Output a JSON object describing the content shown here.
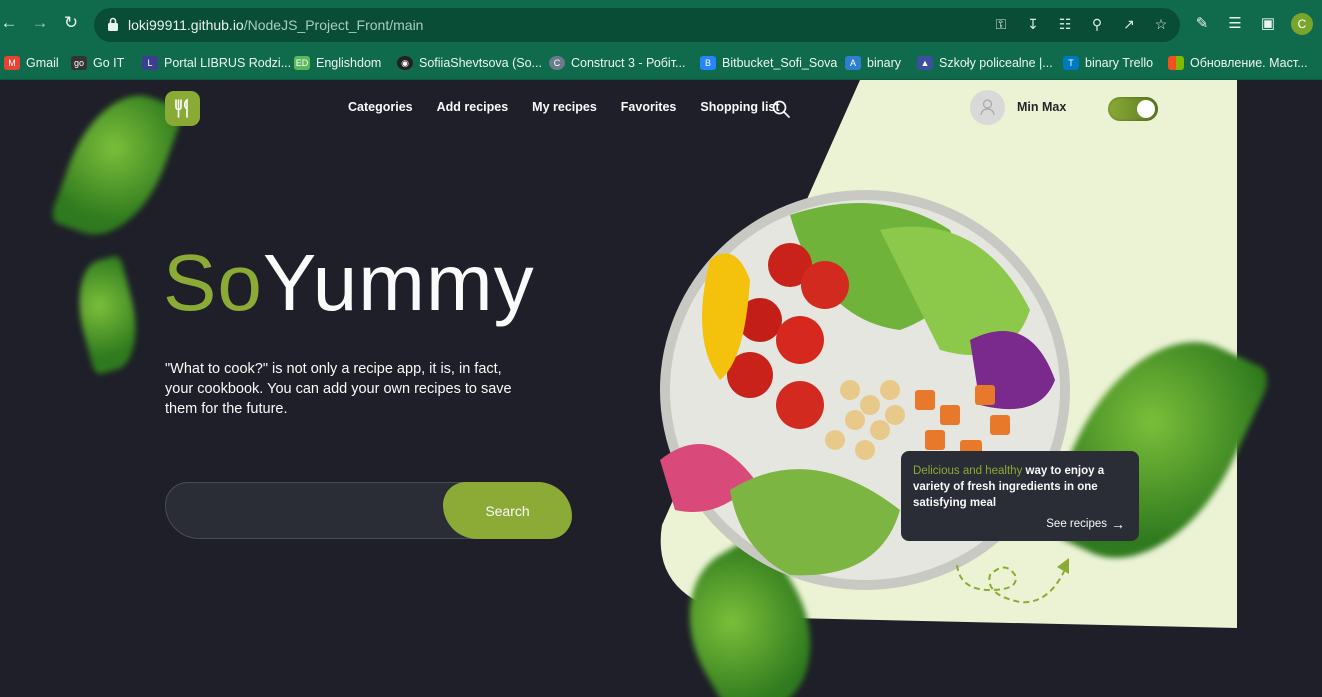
{
  "browser": {
    "url_host": "loki99911.github.io",
    "url_path": "/NodeJS_Project_Front/main",
    "profile_initial": "C",
    "bookmarks": [
      {
        "label": "Gmail",
        "icon": "gmail-icon",
        "color": "#ea4335"
      },
      {
        "label": "Go IT",
        "icon": "goit-icon",
        "color": "#333333"
      },
      {
        "label": "Portal LIBRUS Rodzi...",
        "icon": "librus-icon",
        "color": "#3a3f8f"
      },
      {
        "label": "Englishdom",
        "icon": "englishdom-icon",
        "color": "#5cb85c"
      },
      {
        "label": "SofiiaShevtsova (So...",
        "icon": "github-icon",
        "color": "#222222"
      },
      {
        "label": "Construct 3 - Робіт...",
        "icon": "construct-icon",
        "color": "#6a7b8c"
      },
      {
        "label": "Bitbucket_Sofi_Sova",
        "icon": "bitbucket-icon",
        "color": "#2684ff"
      },
      {
        "label": "binary",
        "icon": "azure-icon",
        "color": "#2f7fd1"
      },
      {
        "label": "Szkoły policealne |...",
        "icon": "school-icon",
        "color": "#3c4fa0"
      },
      {
        "label": "binary Trello",
        "icon": "trello-icon",
        "color": "#0079bf"
      },
      {
        "label": "Обновление. Маст...",
        "icon": "microsoft-icon",
        "color": "#f25022"
      }
    ]
  },
  "header": {
    "nav": [
      "Categories",
      "Add recipes",
      "My recipes",
      "Favorites",
      "Shopping list"
    ],
    "user_name": "Min Max",
    "theme_toggle_on": true
  },
  "hero": {
    "title_accent": "So",
    "title_rest": "Yummy",
    "description": "\"What to cook?\" is not only a recipe app, it is, in fact, your cookbook. You can add your own recipes to save them for the future.",
    "search_placeholder": "",
    "search_button": "Search"
  },
  "promo_card": {
    "accent": "Delicious and healthy",
    "text": " way to enjoy a variety of fresh ingredients in one satisfying meal",
    "link": "See recipes"
  },
  "colors": {
    "accent": "#8baa36",
    "dark_bg": "#1e1f28",
    "light_panel": "#ebf3d4"
  }
}
